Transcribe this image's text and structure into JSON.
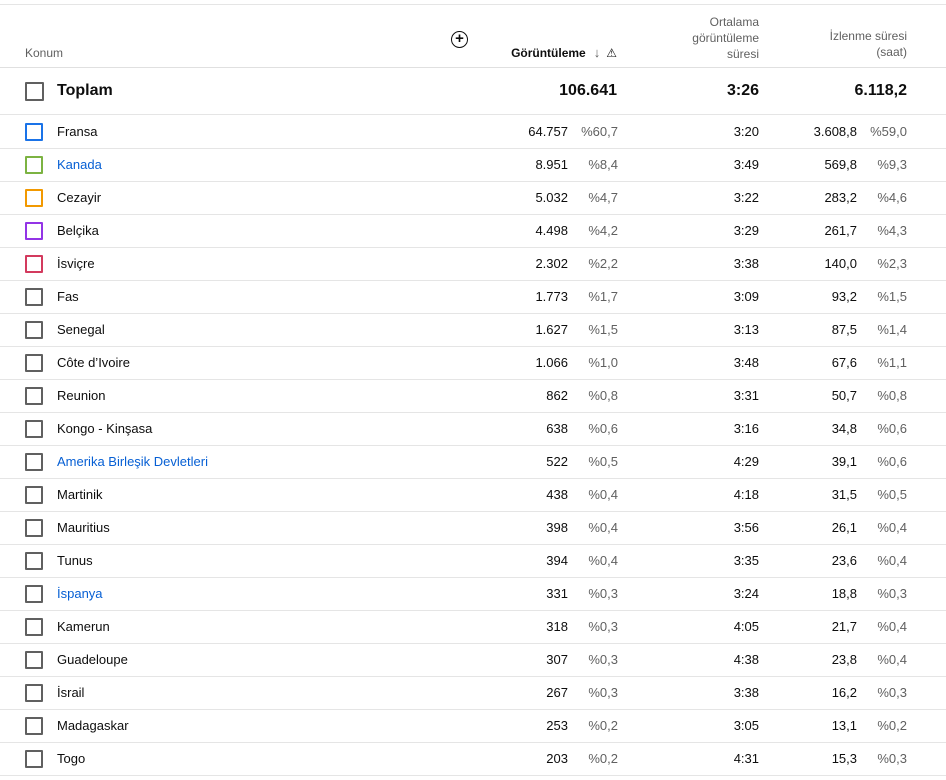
{
  "header": {
    "location": "Konum",
    "views": "Görüntüleme",
    "avg_duration_lines": [
      "Ortalama",
      "görüntüleme",
      "süresi"
    ],
    "watch_time_lines": [
      "İzlenme süresi",
      "(saat)"
    ]
  },
  "total": {
    "label": "Toplam",
    "views": "106.641",
    "avg": "3:26",
    "watch": "6.118,2"
  },
  "rows": [
    {
      "name": "Fransa",
      "link": false,
      "cb_color": "#1a73e8",
      "views": "64.757",
      "vpct": "%60,7",
      "avg": "3:20",
      "watch": "3.608,8",
      "wpct": "%59,0"
    },
    {
      "name": "Kanada",
      "link": true,
      "cb_color": "#7cb342",
      "views": "8.951",
      "vpct": "%8,4",
      "avg": "3:49",
      "watch": "569,8",
      "wpct": "%9,3"
    },
    {
      "name": "Cezayir",
      "link": false,
      "cb_color": "#f29900",
      "views": "5.032",
      "vpct": "%4,7",
      "avg": "3:22",
      "watch": "283,2",
      "wpct": "%4,6"
    },
    {
      "name": "Belçika",
      "link": false,
      "cb_color": "#9334e6",
      "views": "4.498",
      "vpct": "%4,2",
      "avg": "3:29",
      "watch": "261,7",
      "wpct": "%4,3"
    },
    {
      "name": "İsviçre",
      "link": false,
      "cb_color": "#d33a5e",
      "views": "2.302",
      "vpct": "%2,2",
      "avg": "3:38",
      "watch": "140,0",
      "wpct": "%2,3"
    },
    {
      "name": "Fas",
      "link": false,
      "cb_color": "#606060",
      "views": "1.773",
      "vpct": "%1,7",
      "avg": "3:09",
      "watch": "93,2",
      "wpct": "%1,5"
    },
    {
      "name": "Senegal",
      "link": false,
      "cb_color": "#606060",
      "views": "1.627",
      "vpct": "%1,5",
      "avg": "3:13",
      "watch": "87,5",
      "wpct": "%1,4"
    },
    {
      "name": "Côte d’Ivoire",
      "link": false,
      "cb_color": "#606060",
      "views": "1.066",
      "vpct": "%1,0",
      "avg": "3:48",
      "watch": "67,6",
      "wpct": "%1,1"
    },
    {
      "name": "Reunion",
      "link": false,
      "cb_color": "#606060",
      "views": "862",
      "vpct": "%0,8",
      "avg": "3:31",
      "watch": "50,7",
      "wpct": "%0,8"
    },
    {
      "name": "Kongo - Kinşasa",
      "link": false,
      "cb_color": "#606060",
      "views": "638",
      "vpct": "%0,6",
      "avg": "3:16",
      "watch": "34,8",
      "wpct": "%0,6"
    },
    {
      "name": "Amerika Birleşik Devletleri",
      "link": true,
      "cb_color": "#606060",
      "views": "522",
      "vpct": "%0,5",
      "avg": "4:29",
      "watch": "39,1",
      "wpct": "%0,6"
    },
    {
      "name": "Martinik",
      "link": false,
      "cb_color": "#606060",
      "views": "438",
      "vpct": "%0,4",
      "avg": "4:18",
      "watch": "31,5",
      "wpct": "%0,5"
    },
    {
      "name": "Mauritius",
      "link": false,
      "cb_color": "#606060",
      "views": "398",
      "vpct": "%0,4",
      "avg": "3:56",
      "watch": "26,1",
      "wpct": "%0,4"
    },
    {
      "name": "Tunus",
      "link": false,
      "cb_color": "#606060",
      "views": "394",
      "vpct": "%0,4",
      "avg": "3:35",
      "watch": "23,6",
      "wpct": "%0,4"
    },
    {
      "name": "İspanya",
      "link": true,
      "cb_color": "#606060",
      "views": "331",
      "vpct": "%0,3",
      "avg": "3:24",
      "watch": "18,8",
      "wpct": "%0,3"
    },
    {
      "name": "Kamerun",
      "link": false,
      "cb_color": "#606060",
      "views": "318",
      "vpct": "%0,3",
      "avg": "4:05",
      "watch": "21,7",
      "wpct": "%0,4"
    },
    {
      "name": "Guadeloupe",
      "link": false,
      "cb_color": "#606060",
      "views": "307",
      "vpct": "%0,3",
      "avg": "4:38",
      "watch": "23,8",
      "wpct": "%0,4"
    },
    {
      "name": "İsrail",
      "link": false,
      "cb_color": "#606060",
      "views": "267",
      "vpct": "%0,3",
      "avg": "3:38",
      "watch": "16,2",
      "wpct": "%0,3"
    },
    {
      "name": "Madagaskar",
      "link": false,
      "cb_color": "#606060",
      "views": "253",
      "vpct": "%0,2",
      "avg": "3:05",
      "watch": "13,1",
      "wpct": "%0,2"
    },
    {
      "name": "Togo",
      "link": false,
      "cb_color": "#606060",
      "views": "203",
      "vpct": "%0,2",
      "avg": "4:31",
      "watch": "15,3",
      "wpct": "%0,3"
    }
  ]
}
